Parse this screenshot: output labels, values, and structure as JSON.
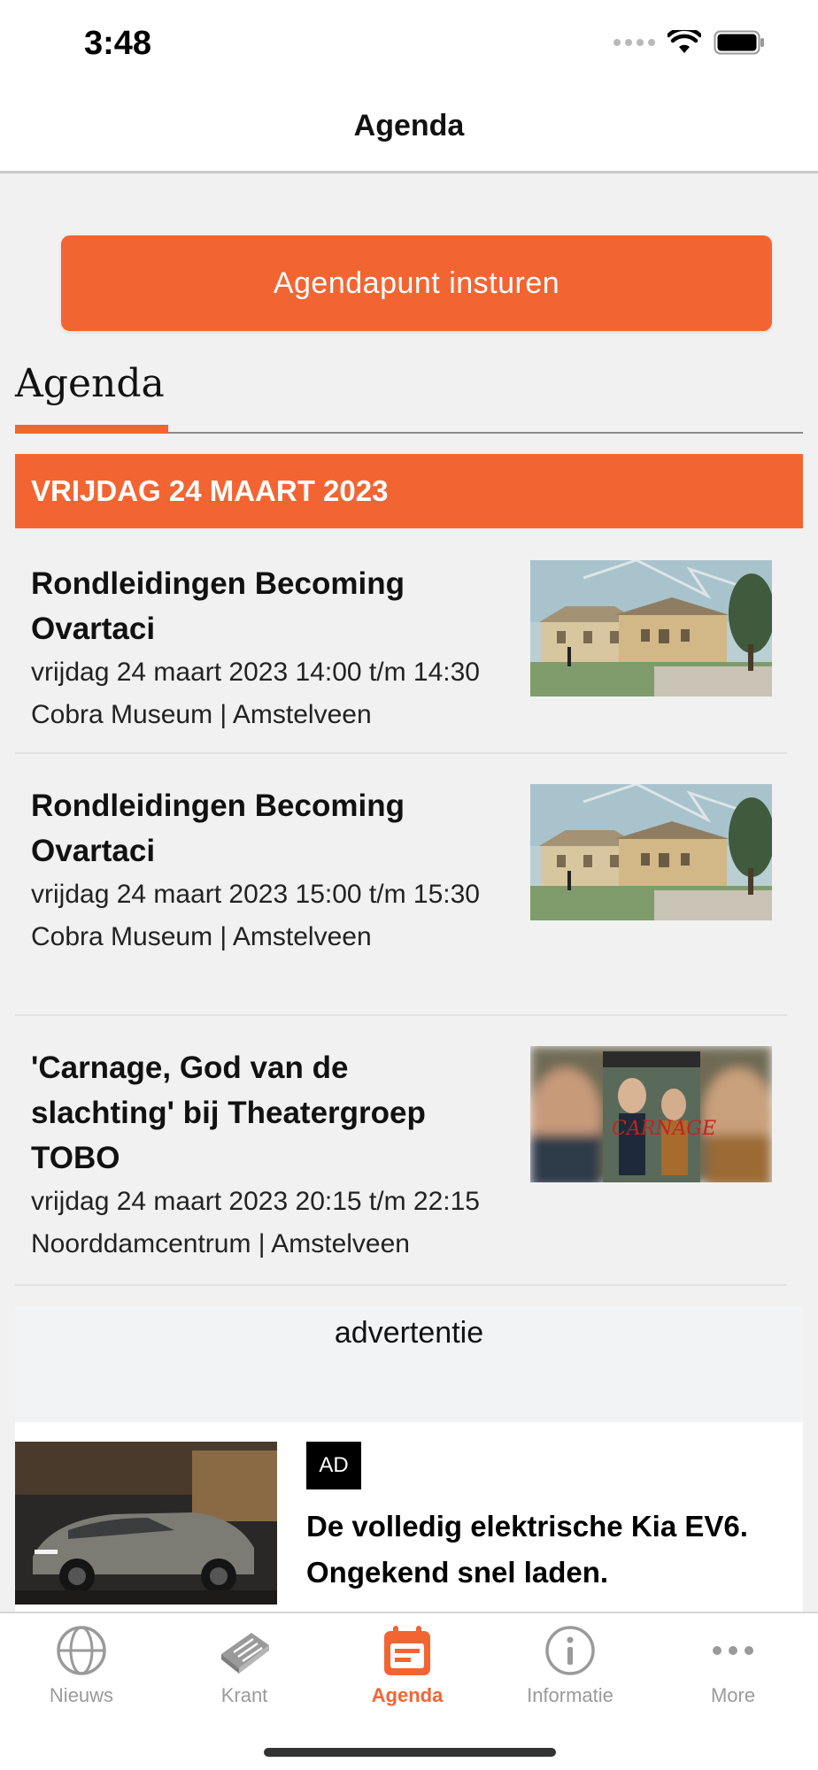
{
  "status_bar": {
    "time": "3:48"
  },
  "nav": {
    "title": "Agenda"
  },
  "submit_button": {
    "label": "Agendapunt insturen"
  },
  "section": {
    "title": "Agenda"
  },
  "date_banner": {
    "label": "VRIJDAG 24 MAART 2023"
  },
  "events": [
    {
      "title_line1": "Rondleidingen Becoming",
      "title_line2": "Ovartaci",
      "title_line3": "",
      "time": "vrijdag 24 maart 2023 14:00 t/m 14:30",
      "venue": "Cobra Museum | Amstelveen",
      "thumb": "museum-painting"
    },
    {
      "title_line1": "Rondleidingen Becoming",
      "title_line2": "Ovartaci",
      "title_line3": "",
      "time": "vrijdag 24 maart 2023 15:00 t/m 15:30",
      "venue": "Cobra Museum | Amstelveen",
      "thumb": "museum-painting"
    },
    {
      "title_line1": "'Carnage, God van de",
      "title_line2": "slachting' bij Theatergroep",
      "title_line3": "TOBO",
      "time": "vrijdag 24 maart 2023 20:15 t/m 22:15",
      "venue": "Noorddamcentrum | Amstelveen",
      "thumb": "theater-poster"
    }
  ],
  "advertisement": {
    "label": "advertentie",
    "badge": "AD",
    "headline": "De volledig elektrische Kia EV6. Ongekend snel laden."
  },
  "tabs": [
    {
      "label": "Nieuws",
      "icon": "globe-icon",
      "active": false
    },
    {
      "label": "Krant",
      "icon": "newspaper-icon",
      "active": false
    },
    {
      "label": "Agenda",
      "icon": "calendar-icon",
      "active": true
    },
    {
      "label": "Informatie",
      "icon": "info-icon",
      "active": false
    },
    {
      "label": "More",
      "icon": "more-icon",
      "active": false
    }
  ],
  "colors": {
    "accent": "#f26532",
    "background": "#f1f1f1",
    "tab_inactive": "#9a9a9a"
  }
}
